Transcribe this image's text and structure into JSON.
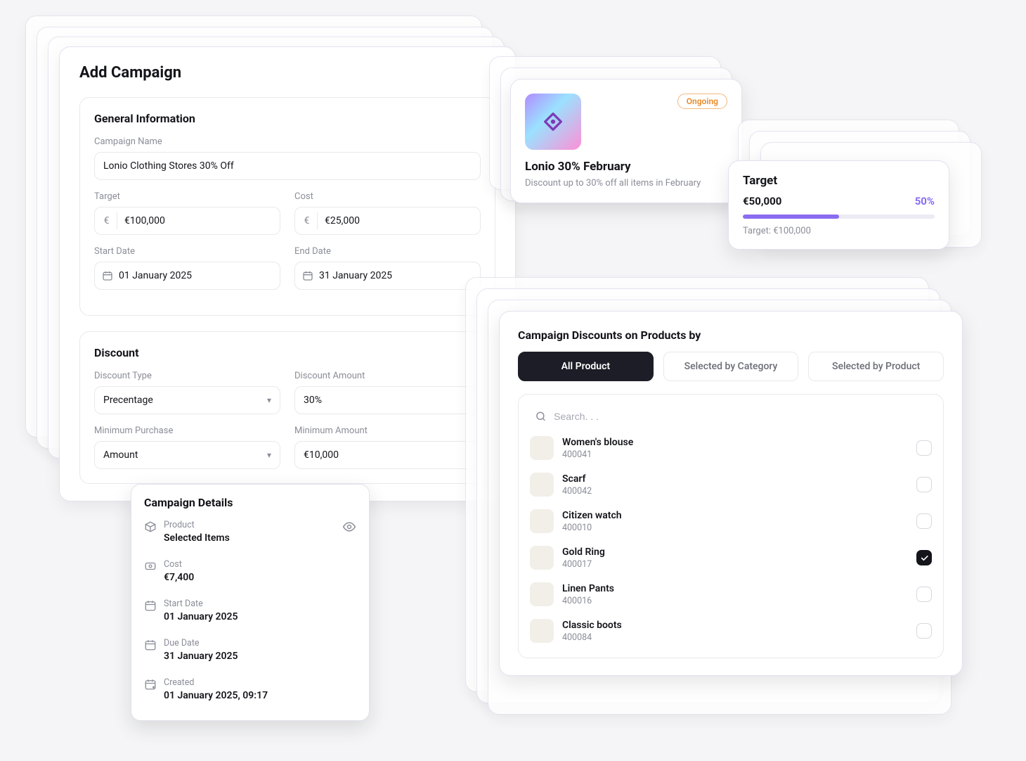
{
  "add_campaign": {
    "title": "Add Campaign",
    "general": {
      "section_title": "General Information",
      "name_label": "Campaign Name",
      "name_value": "Lonio Clothing Stores 30% Off",
      "target_label": "Target",
      "target_value": "€100,000",
      "cost_label": "Cost",
      "cost_value": "€25,000",
      "start_label": "Start Date",
      "start_value": "01 January 2025",
      "end_label": "End Date",
      "end_value": "31 January 2025",
      "currency_symbol": "€"
    },
    "discount": {
      "section_title": "Discount",
      "type_label": "Discount Type",
      "type_value": "Precentage",
      "amount_label": "Discount Amount",
      "amount_value": "30%",
      "min_purchase_label": "Minimum Purchase",
      "min_purchase_value": "Amount",
      "min_amount_label": "Minimum Amount",
      "min_amount_value": "€10,000"
    }
  },
  "details": {
    "title": "Campaign Details",
    "product_label": "Product",
    "product_value": "Selected Items",
    "cost_label": "Cost",
    "cost_value": "€7,400",
    "start_label": "Start Date",
    "start_value": "01 January 2025",
    "due_label": "Due Date",
    "due_value": "31 January 2025",
    "created_label": "Created",
    "created_value": "01 January 2025, 09:17"
  },
  "lonio": {
    "status": "Ongoing",
    "title": "Lonio 30% February",
    "subtitle": "Discount up to 30% off all items in February"
  },
  "target": {
    "title": "Target",
    "current": "€50,000",
    "pct_label": "50%",
    "pct": 50,
    "goal_label": "Target: €100,000"
  },
  "products": {
    "title": "Campaign Discounts on Products by",
    "tabs": {
      "all": "All Product",
      "category": "Selected by Category",
      "product": "Selected by Product"
    },
    "search_placeholder": "Search. . .",
    "items": [
      {
        "name": "Women's blouse",
        "sku": "400041",
        "checked": false
      },
      {
        "name": "Scarf",
        "sku": "400042",
        "checked": false
      },
      {
        "name": "Citizen watch",
        "sku": "400010",
        "checked": false
      },
      {
        "name": "Gold Ring",
        "sku": "400017",
        "checked": true
      },
      {
        "name": "Linen Pants",
        "sku": "400016",
        "checked": false
      },
      {
        "name": "Classic boots",
        "sku": "400084",
        "checked": false
      }
    ]
  }
}
